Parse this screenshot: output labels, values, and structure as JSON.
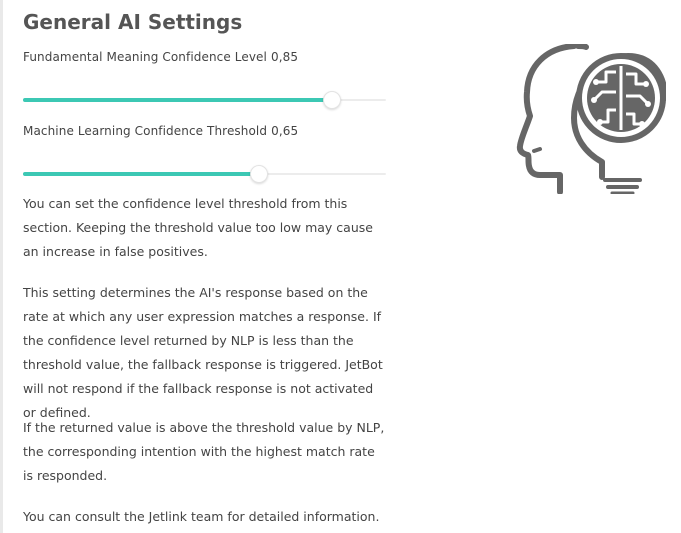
{
  "page": {
    "title": "General AI Settings"
  },
  "sliders": [
    {
      "label": "Fundamental Meaning Confidence Level",
      "value_text": "0,85",
      "value": 0.85
    },
    {
      "label": "Machine Learning Confidence Threshold",
      "value_text": "0,65",
      "value": 0.65
    }
  ],
  "paragraphs": [
    "You can set the confidence level threshold from this section. Keeping the threshold value too low may cause an increase in false positives.",
    "This setting determines the AI's response based on the rate at which any user expression matches a response. If the confidence level returned by NLP is less than the threshold value, the fallback response is triggered. JetBot will not respond if the fallback response is not activated or defined.",
    "If the returned value is above the threshold value by NLP, the corresponding intention with the highest match rate is responded.",
    "You can consult the Jetlink team for detailed information."
  ],
  "illustration": {
    "icon": "ai-head-brain-icon"
  },
  "colors": {
    "accent": "#3cc8b4",
    "icon": "#666666"
  }
}
